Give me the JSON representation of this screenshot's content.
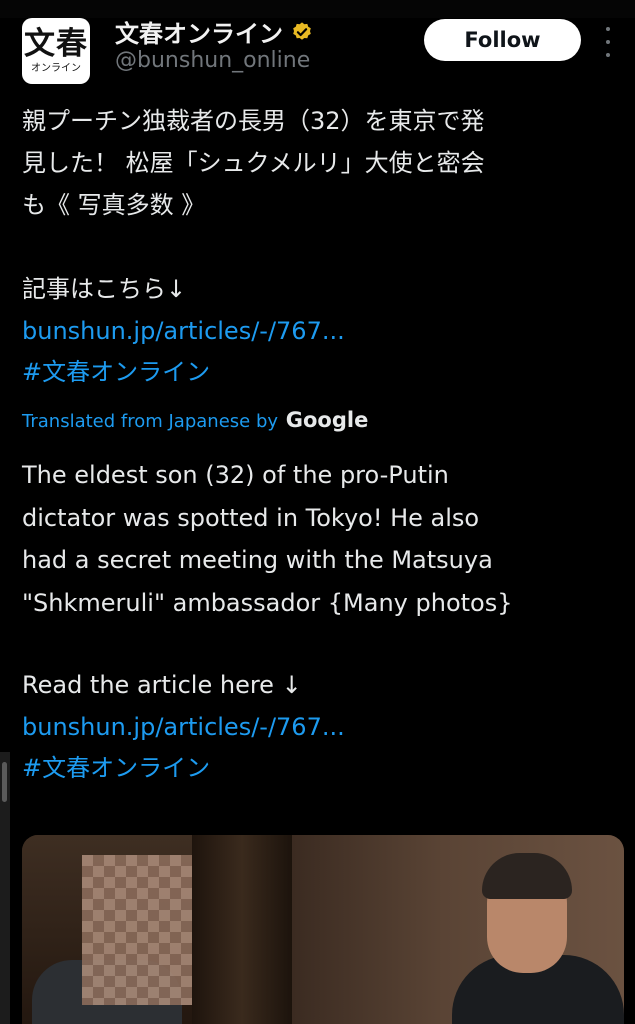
{
  "account": {
    "avatar_main": "文春",
    "avatar_sub": "オンライン",
    "display_name": "文春オンライン",
    "handle": "@bunshun_online",
    "verified_color": "#e8b923"
  },
  "actions": {
    "follow_label": "Follow"
  },
  "post": {
    "original_lines": [
      "親プーチン独裁者の長男（32）を東京で発",
      "見した！ 松屋「シュクメルリ」大使と密会",
      "も《 写真多数 》"
    ],
    "original_read_more": "記事はこちら↓",
    "original_link": "bunshun.jp/articles/-/767...",
    "original_hashtag": "#文春オンライン",
    "translated_by_prefix": "Translated from Japanese by",
    "translated_by_service": "Google",
    "translated_lines": [
      "The eldest son (32) of the pro-Putin",
      "dictator was spotted in Tokyo! He also",
      "had a secret meeting with the Matsuya",
      "\"Shkmeruli\" ambassador {Many photos}"
    ],
    "translated_read_more": "Read the article here ↓",
    "translated_link": "bunshun.jp/articles/-/767...",
    "translated_hashtag": "#文春オンライン"
  },
  "colors": {
    "background": "#000000",
    "text": "#e7e9ea",
    "muted": "#71767b",
    "link": "#1d9bf0"
  }
}
